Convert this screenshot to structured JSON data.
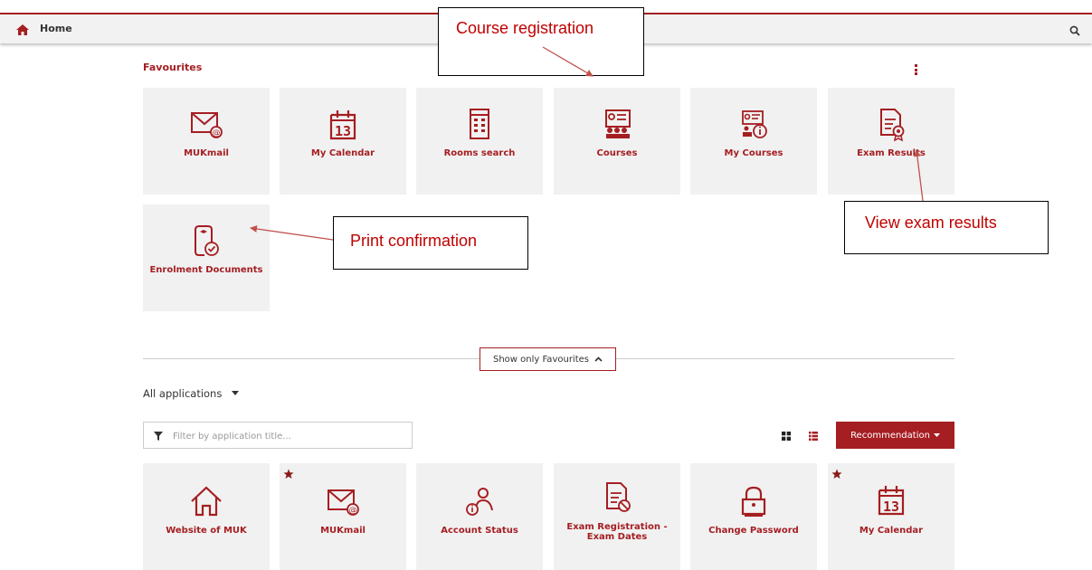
{
  "topbar": {
    "home_label": "Home",
    "home_icon": "home-icon",
    "search_icon": "search-icon"
  },
  "favourites": {
    "title": "Favourites",
    "menu_icon": "kebab-menu-icon",
    "tiles": [
      {
        "label": "MUKmail",
        "icon": "mail-icon"
      },
      {
        "label": "My Calendar",
        "icon": "calendar-icon"
      },
      {
        "label": "Rooms search",
        "icon": "building-icon"
      },
      {
        "label": "Courses",
        "icon": "courses-icon"
      },
      {
        "label": "My Courses",
        "icon": "my-courses-icon"
      },
      {
        "label": "Exam Results",
        "icon": "exam-results-icon"
      },
      {
        "label": "Enrolment Documents",
        "icon": "enrolment-documents-icon"
      }
    ]
  },
  "show_favourites_label": "Show only Favourites",
  "all_applications": {
    "label": "All applications",
    "filter_placeholder": "Filter by application title...",
    "recommendation_label": "Recommendation",
    "tiles": [
      {
        "label": "Website of MUK",
        "icon": "house-icon",
        "starred": false
      },
      {
        "label": "MUKmail",
        "icon": "mail-icon",
        "starred": true
      },
      {
        "label": "Account Status",
        "icon": "account-status-icon",
        "starred": false
      },
      {
        "label": "Exam Registration - Exam Dates",
        "icon": "exam-registration-icon",
        "starred": false
      },
      {
        "label": "Change Password",
        "icon": "lock-icon",
        "starred": false
      },
      {
        "label": "My Calendar",
        "icon": "calendar-icon",
        "starred": true
      }
    ]
  },
  "annotations": {
    "course_registration": "Course registration",
    "view_exam_results": "View exam results",
    "print_confirmation": "Print confirmation"
  },
  "colors": {
    "accent": "#a51e22",
    "tile_bg": "#f1f1f1",
    "callout_text": "#c00000"
  }
}
